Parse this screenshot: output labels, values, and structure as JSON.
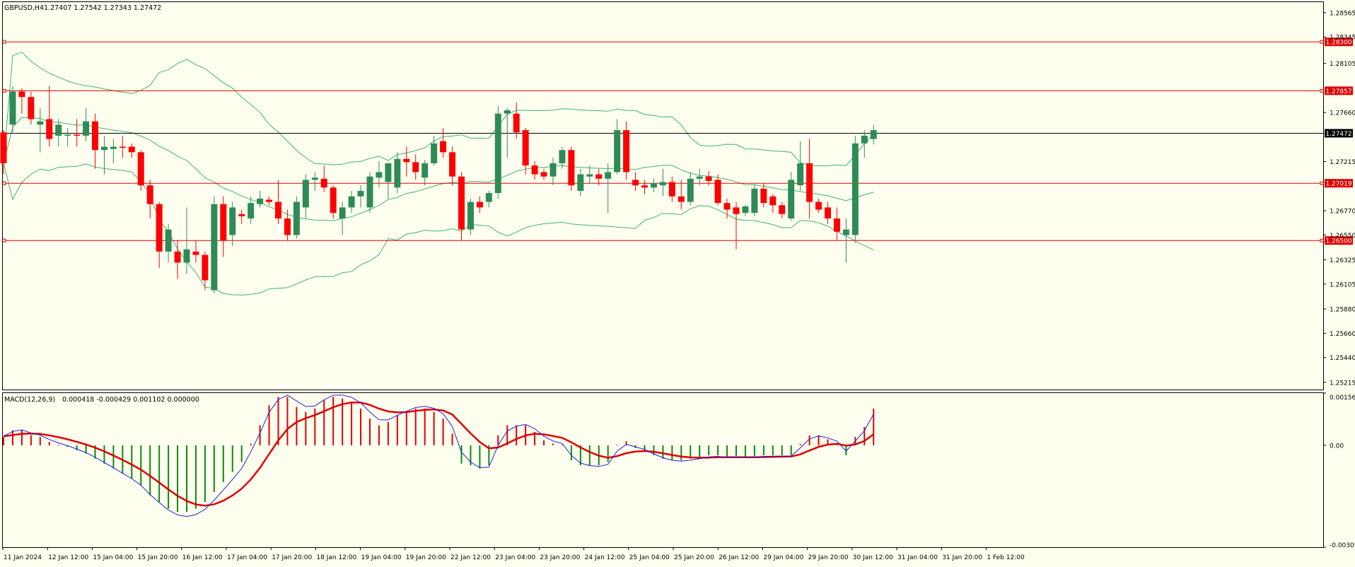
{
  "header": {
    "symbol_label": "GBPUSD,H4",
    "ohlc_values": "1.27407 1.27542 1.27343 1.27472"
  },
  "macd_header": {
    "label": "MACD(12,26,9)",
    "values": "0.000418 -0.000429 0.001102 0.000000"
  },
  "colors": {
    "background": "#fffff0",
    "bull_candle": "#2e8b57",
    "bear_candle": "#ff0000",
    "bollinger": "#3cb371",
    "hline": "#e00000",
    "current_price_line": "#000000",
    "macd_signal": "#e00000",
    "macd_main": "#1f1fd6",
    "hist_pos": "#e00000",
    "hist_neg": "#0a8a0a"
  },
  "chart_data": [
    {
      "type": "candlestick",
      "symbol": "GBPUSD",
      "timeframe": "H4",
      "ylim": [
        1.2515,
        1.2866
      ],
      "price_ticks": [
        "1.28565",
        "1.28345",
        "1.28105",
        "1.27660",
        "1.27215",
        "1.26770",
        "1.26550",
        "1.26325",
        "1.26105",
        "1.25880",
        "1.25660",
        "1.25440",
        "1.25215"
      ],
      "time_labels": [
        "11 Jan 2024",
        "12 Jan 12:00",
        "15 Jan 04:00",
        "15 Jan 20:00",
        "16 Jan 12:00",
        "17 Jan 04:00",
        "17 Jan 20:00",
        "18 Jan 12:00",
        "19 Jan 04:00",
        "19 Jan 20:00",
        "22 Jan 12:00",
        "23 Jan 04:00",
        "23 Jan 20:00",
        "24 Jan 12:00",
        "25 Jan 04:00",
        "25 Jan 20:00",
        "26 Jan 12:00",
        "29 Jan 04:00",
        "29 Jan 20:00",
        "30 Jan 12:00",
        "31 Jan 04:00",
        "31 Jan 20:00",
        "1 Feb 12:00"
      ],
      "horizontal_levels": [
        {
          "price": 1.283,
          "label": "1.28300"
        },
        {
          "price": 1.27857,
          "label": "1.27857"
        },
        {
          "price": 1.27019,
          "label": "1.27019"
        },
        {
          "price": 1.265,
          "label": "1.26500"
        }
      ],
      "current_price": {
        "price": 1.27472,
        "label": "1.27472"
      },
      "candles": [
        [
          1.2748,
          1.275,
          1.271,
          1.272
        ],
        [
          1.2755,
          1.279,
          1.2748,
          1.2785
        ],
        [
          1.2785,
          1.2788,
          1.2765,
          1.278
        ],
        [
          1.278,
          1.2785,
          1.2755,
          1.276
        ],
        [
          1.2755,
          1.277,
          1.273,
          1.2758
        ],
        [
          1.276,
          1.279,
          1.2735,
          1.2742
        ],
        [
          1.2745,
          1.276,
          1.2735,
          1.2755
        ],
        [
          1.2745,
          1.2752,
          1.2735,
          1.2746
        ],
        [
          1.2746,
          1.276,
          1.2735,
          1.2745
        ],
        [
          1.2745,
          1.277,
          1.274,
          1.2758
        ],
        [
          1.2758,
          1.2765,
          1.2715,
          1.2732
        ],
        [
          1.2732,
          1.2745,
          1.271,
          1.2735
        ],
        [
          1.2733,
          1.2742,
          1.272,
          1.2735
        ],
        [
          1.2735,
          1.2745,
          1.2725,
          1.2734
        ],
        [
          1.2735,
          1.2738,
          1.2725,
          1.273
        ],
        [
          1.273,
          1.2732,
          1.2695,
          1.27
        ],
        [
          1.27,
          1.2705,
          1.267,
          1.2683
        ],
        [
          1.2683,
          1.2685,
          1.2625,
          1.264
        ],
        [
          1.264,
          1.2665,
          1.263,
          1.266
        ],
        [
          1.264,
          1.265,
          1.2615,
          1.263
        ],
        [
          1.263,
          1.268,
          1.262,
          1.2642
        ],
        [
          1.264,
          1.265,
          1.263,
          1.2637
        ],
        [
          1.2637,
          1.264,
          1.2605,
          1.2614
        ],
        [
          1.2605,
          1.269,
          1.2602,
          1.2683
        ],
        [
          1.2683,
          1.269,
          1.2635,
          1.265
        ],
        [
          1.2655,
          1.2685,
          1.2645,
          1.268
        ],
        [
          1.2674,
          1.2678,
          1.2665,
          1.2672
        ],
        [
          1.267,
          1.269,
          1.2665,
          1.2684
        ],
        [
          1.2683,
          1.2695,
          1.268,
          1.2688
        ],
        [
          1.2687,
          1.269,
          1.2682,
          1.2685
        ],
        [
          1.2685,
          1.2705,
          1.2665,
          1.267
        ],
        [
          1.267,
          1.2678,
          1.265,
          1.2655
        ],
        [
          1.2655,
          1.269,
          1.2652,
          1.2685
        ],
        [
          1.268,
          1.271,
          1.267,
          1.2705
        ],
        [
          1.2705,
          1.2712,
          1.2695,
          1.2707
        ],
        [
          1.2706,
          1.2718,
          1.2694,
          1.2698
        ],
        [
          1.2698,
          1.27,
          1.267,
          1.2675
        ],
        [
          1.267,
          1.2685,
          1.2655,
          1.268
        ],
        [
          1.268,
          1.2695,
          1.2675,
          1.269
        ],
        [
          1.269,
          1.27,
          1.268,
          1.2695
        ],
        [
          1.268,
          1.2712,
          1.2675,
          1.2708
        ],
        [
          1.2707,
          1.2722,
          1.2698,
          1.2712
        ],
        [
          1.2703,
          1.2713,
          1.2688,
          1.272
        ],
        [
          1.2698,
          1.273,
          1.2693,
          1.2724
        ],
        [
          1.2724,
          1.2735,
          1.2708,
          1.2721
        ],
        [
          1.2721,
          1.2728,
          1.2705,
          1.2712
        ],
        [
          1.2707,
          1.2723,
          1.27,
          1.272
        ],
        [
          1.272,
          1.2745,
          1.2718,
          1.2738
        ],
        [
          1.274,
          1.2752,
          1.2725,
          1.273
        ],
        [
          1.273,
          1.2735,
          1.27,
          1.2708
        ],
        [
          1.2708,
          1.2712,
          1.265,
          1.266
        ],
        [
          1.266,
          1.2688,
          1.2655,
          1.2685
        ],
        [
          1.2685,
          1.269,
          1.2675,
          1.268
        ],
        [
          1.2685,
          1.2695,
          1.268,
          1.2693
        ],
        [
          1.2693,
          1.2772,
          1.2688,
          1.2765
        ],
        [
          1.2765,
          1.277,
          1.2725,
          1.2768
        ],
        [
          1.2765,
          1.2775,
          1.2742,
          1.2748
        ],
        [
          1.275,
          1.2752,
          1.271,
          1.2718
        ],
        [
          1.2718,
          1.2722,
          1.2705,
          1.271
        ],
        [
          1.2712,
          1.2715,
          1.2705,
          1.2708
        ],
        [
          1.2708,
          1.2725,
          1.27,
          1.272
        ],
        [
          1.272,
          1.2735,
          1.2715,
          1.2732
        ],
        [
          1.2732,
          1.2735,
          1.2695,
          1.27
        ],
        [
          1.2695,
          1.2715,
          1.269,
          1.271
        ],
        [
          1.2708,
          1.2718,
          1.2702,
          1.271
        ],
        [
          1.271,
          1.2715,
          1.27,
          1.2706
        ],
        [
          1.2706,
          1.272,
          1.2675,
          1.2712
        ],
        [
          1.2712,
          1.276,
          1.271,
          1.275
        ],
        [
          1.275,
          1.2758,
          1.2705,
          1.2712
        ],
        [
          1.2705,
          1.2712,
          1.2695,
          1.27
        ],
        [
          1.27,
          1.2705,
          1.2692,
          1.2698
        ],
        [
          1.2698,
          1.2706,
          1.2694,
          1.2702
        ],
        [
          1.27,
          1.2715,
          1.269,
          1.2703
        ],
        [
          1.2703,
          1.2708,
          1.2685,
          1.269
        ],
        [
          1.269,
          1.2705,
          1.2678,
          1.2685
        ],
        [
          1.2685,
          1.2712,
          1.2682,
          1.2706
        ],
        [
          1.2706,
          1.2715,
          1.27,
          1.2708
        ],
        [
          1.2708,
          1.2713,
          1.27,
          1.2704
        ],
        [
          1.2705,
          1.271,
          1.2682,
          1.2684
        ],
        [
          1.2684,
          1.2688,
          1.267,
          1.2678
        ],
        [
          1.268,
          1.2685,
          1.2642,
          1.2674
        ],
        [
          1.2675,
          1.2682,
          1.2672,
          1.2681
        ],
        [
          1.2675,
          1.27,
          1.2672,
          1.2697
        ],
        [
          1.2697,
          1.2702,
          1.268,
          1.2684
        ],
        [
          1.269,
          1.2692,
          1.2675,
          1.2682
        ],
        [
          1.2682,
          1.2685,
          1.267,
          1.2674
        ],
        [
          1.267,
          1.2712,
          1.2668,
          1.2705
        ],
        [
          1.27,
          1.274,
          1.2695,
          1.272
        ],
        [
          1.272,
          1.2742,
          1.267,
          1.2685
        ],
        [
          1.2685,
          1.2688,
          1.2675,
          1.2678
        ],
        [
          1.268,
          1.2685,
          1.2665,
          1.267
        ],
        [
          1.267,
          1.268,
          1.265,
          1.2658
        ],
        [
          1.2655,
          1.267,
          1.263,
          1.266
        ],
        [
          1.2655,
          1.2745,
          1.2648,
          1.2738
        ],
        [
          1.2738,
          1.275,
          1.2725,
          1.2745
        ],
        [
          1.2742,
          1.2755,
          1.2737,
          1.275
        ]
      ]
    },
    {
      "type": "macd",
      "title": "MACD(12,26,9)",
      "ylim": [
        -0.003056,
        0.001565
      ],
      "y_ticks": [
        "0.001565",
        "0.00",
        "-0.003056"
      ],
      "histogram": [
        0.00025,
        0.00045,
        0.00045,
        0.0003,
        0.00025,
        0.0001,
        2e-05,
        -5e-05,
        -0.00015,
        -0.00025,
        -0.0004,
        -0.00055,
        -0.0007,
        -0.00085,
        -0.001,
        -0.0012,
        -0.0015,
        -0.0017,
        -0.0019,
        -0.002,
        -0.002,
        -0.0019,
        -0.0017,
        -0.0014,
        -0.0011,
        -0.0008,
        -0.0005,
        5e-05,
        0.0006,
        0.0012,
        0.00145,
        0.00145,
        0.00115,
        0.001,
        0.0011,
        0.00135,
        0.00145,
        0.0014,
        0.0013,
        0.0011,
        0.0008,
        0.0006,
        0.0007,
        0.0009,
        0.001,
        0.0011,
        0.0011,
        0.001,
        0.0008,
        0.00035,
        -0.00055,
        -0.0006,
        -0.0007,
        -0.0006,
        0.0003,
        0.0006,
        0.0006,
        0.0006,
        0.0004,
        0.00015,
        5e-05,
        2e-05,
        -0.00045,
        -0.0006,
        -0.0006,
        -0.0006,
        -0.0005,
        2e-05,
        0.00012,
        -8e-05,
        -0.00015,
        -0.0003,
        -0.0004,
        -0.00045,
        -0.00045,
        -0.0004,
        -0.00035,
        -0.0003,
        -0.0003,
        -0.00035,
        -0.00032,
        -0.00035,
        -0.00032,
        -0.0003,
        -0.0003,
        -0.0003,
        -0.0003,
        4e-05,
        0.0003,
        0.0003,
        0.00018,
        7e-05,
        -0.0003,
        0.00025,
        0.00055,
        0.0011
      ]
    }
  ]
}
